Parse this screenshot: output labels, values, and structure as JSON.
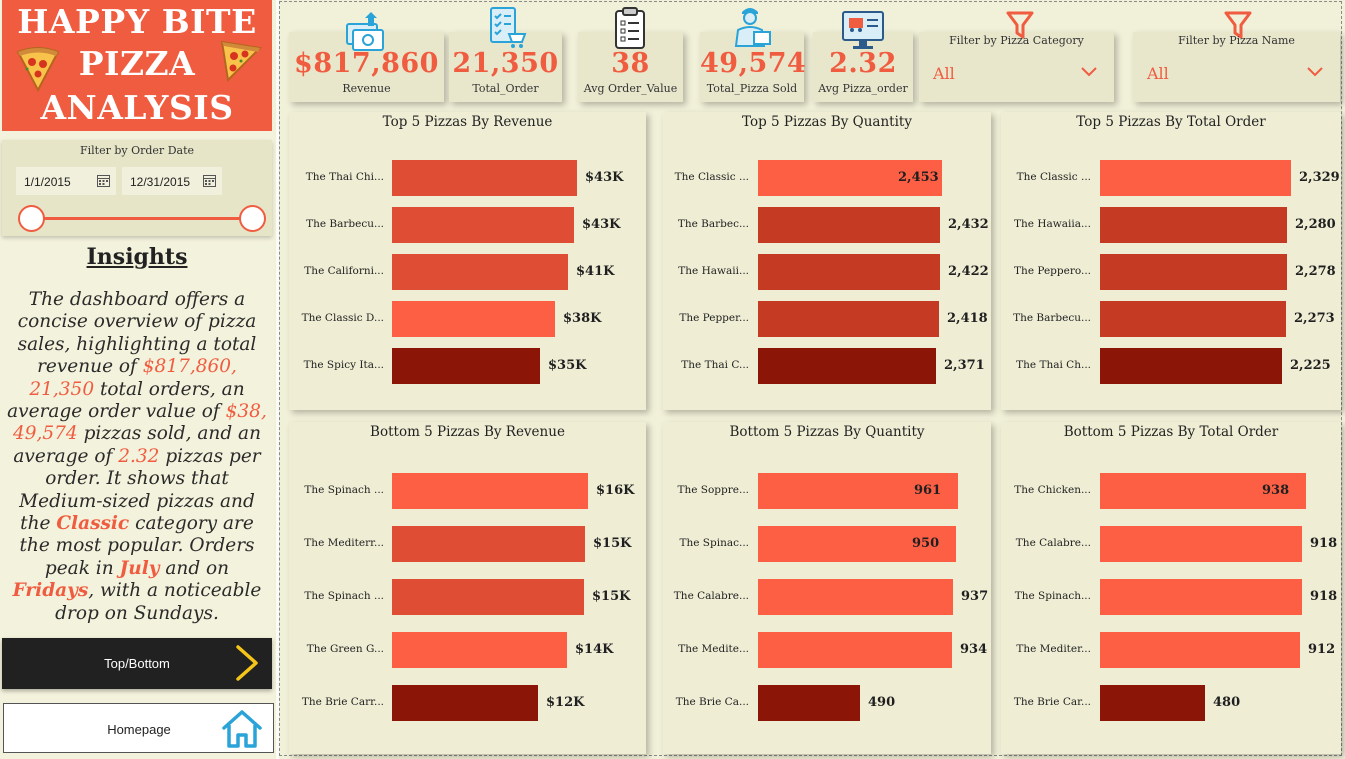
{
  "title": {
    "line1": "HAPPY BITE",
    "line2": "PIZZA",
    "line3": "ANALYSIS"
  },
  "date_filter": {
    "label": "Filter by Order Date",
    "start": "1/1/2015",
    "end": "12/31/2015"
  },
  "insights": {
    "title": "Insights",
    "p1": "The dashboard offers a concise overview of pizza sales, highlighting a total revenue of ",
    "v1": "$817,860, 21,350",
    "p2": " total orders, an average order value of ",
    "v2": "$38, 49,574",
    "p3": " pizzas sold, and an average of ",
    "v3": "2.32",
    "p4": " pizzas per order. It shows that Medium-sized pizzas and the ",
    "v4": "Classic",
    "p5": " category are the most popular. Orders peak in ",
    "v5": "July",
    "p6": " and on ",
    "v6": "Fridays",
    "p7": ", with a noticeable drop on Sundays."
  },
  "nav": {
    "topbottom": "Top/Bottom",
    "home": "Homepage"
  },
  "kpis": [
    {
      "value": "$817,860",
      "label": "Revenue",
      "icon": "money-icon"
    },
    {
      "value": "21,350",
      "label": "Total_Order",
      "icon": "cart-checklist-icon"
    },
    {
      "value": "38",
      "label": "Avg Order_Value",
      "icon": "clipboard-icon"
    },
    {
      "value": "49,574",
      "label": "Total_Pizza Sold",
      "icon": "delivery-person-icon"
    },
    {
      "value": "2.32",
      "label": "Avg Pizza_order",
      "icon": "online-order-icon"
    }
  ],
  "filters": [
    {
      "label": "Filter by Pizza Category",
      "value": "All"
    },
    {
      "label": "Filter by Pizza Name",
      "value": "All"
    }
  ],
  "colors": {
    "accent": "#f05c40",
    "bar_light": "#fd5f45",
    "bar_mid": "#e04d35",
    "bar_dark": "#c43a22",
    "bar_darkest": "#8b1506",
    "bg": "#f1f0d8"
  },
  "chart_data": [
    {
      "type": "bar",
      "title": "Top 5 Pizzas By Revenue",
      "categories": [
        "The Thai Chi...",
        "The Barbecu...",
        "The Californi...",
        "The Classic D...",
        "The Spicy Ita..."
      ],
      "values": [
        43434,
        42768,
        41410,
        38180,
        34831
      ],
      "value_labels": [
        "$43K",
        "$43K",
        "$41K",
        "$38K",
        "$35K"
      ]
    },
    {
      "type": "bar",
      "title": "Top 5 Pizzas By Quantity",
      "categories": [
        "The Classic ...",
        "The Barbec...",
        "The Hawaii...",
        "The Pepper...",
        "The Thai C..."
      ],
      "values": [
        2453,
        2432,
        2422,
        2418,
        2371
      ],
      "value_labels": [
        "2,453",
        "2,432",
        "2,422",
        "2,418",
        "2,371"
      ]
    },
    {
      "type": "bar",
      "title": "Top 5 Pizzas By Total Order",
      "categories": [
        "The Classic ...",
        "The Hawaiia...",
        "The Peppero...",
        "The Barbecu...",
        "The Thai Ch..."
      ],
      "values": [
        2329,
        2280,
        2278,
        2273,
        2225
      ],
      "value_labels": [
        "2,329",
        "2,280",
        "2,278",
        "2,273",
        "2,225"
      ]
    },
    {
      "type": "bar",
      "title": "Bottom 5 Pizzas By Revenue",
      "categories": [
        "The Spinach ...",
        "The Mediterr...",
        "The Spinach ...",
        "The Green G...",
        "The Brie Carr..."
      ],
      "values": [
        15596,
        15360,
        15277,
        13956,
        11589
      ],
      "value_labels": [
        "$16K",
        "$15K",
        "$15K",
        "$14K",
        "$12K"
      ]
    },
    {
      "type": "bar",
      "title": "Bottom 5 Pizzas By Quantity",
      "categories": [
        "The Soppre...",
        "The Spinac...",
        "The Calabre...",
        "The Medite...",
        "The Brie Ca..."
      ],
      "values": [
        961,
        950,
        937,
        934,
        490
      ],
      "value_labels": [
        "961",
        "950",
        "937",
        "934",
        "490"
      ]
    },
    {
      "type": "bar",
      "title": "Bottom 5 Pizzas By Total Order",
      "categories": [
        "The Chicken...",
        "The Calabre...",
        "The Spinach...",
        "The Mediter...",
        "The Brie Car..."
      ],
      "values": [
        938,
        918,
        918,
        912,
        480
      ],
      "value_labels": [
        "938",
        "918",
        "918",
        "912",
        "480"
      ]
    }
  ]
}
